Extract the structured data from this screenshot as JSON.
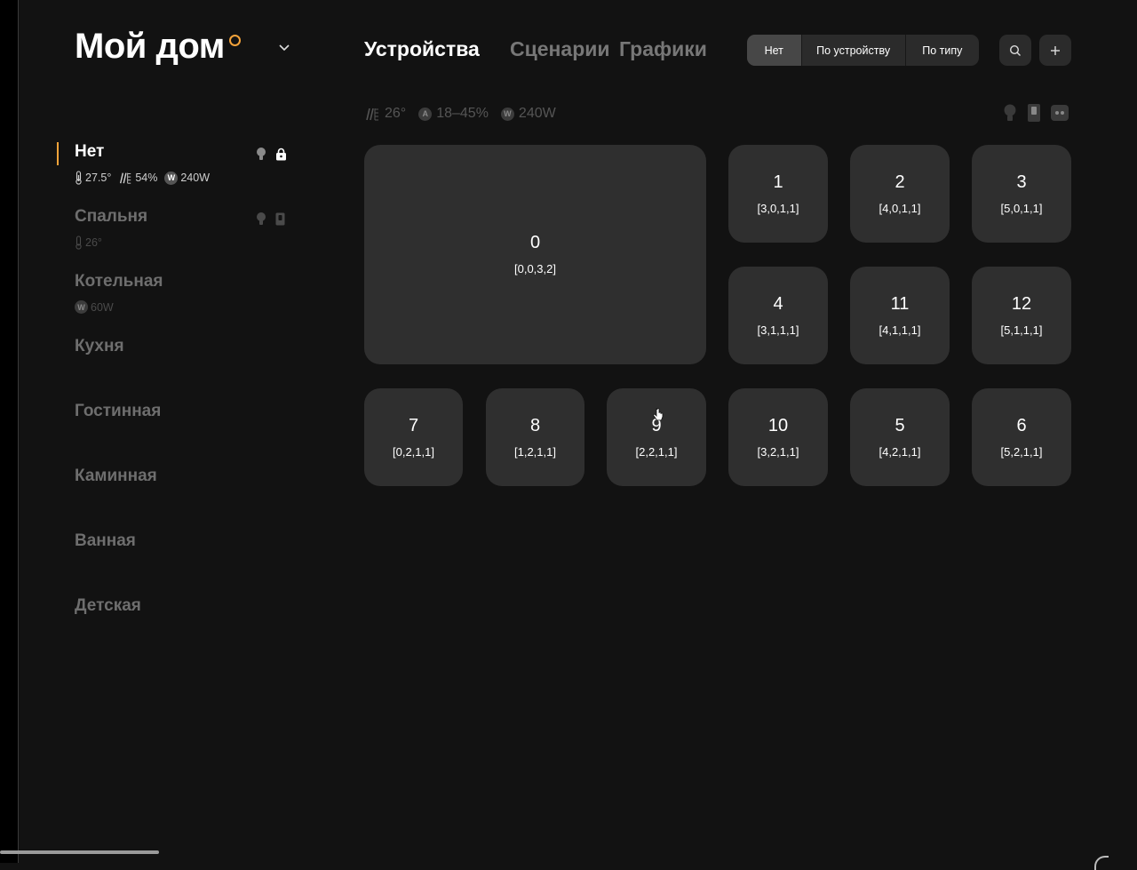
{
  "home": {
    "title": "Мой дом"
  },
  "nav": {
    "tabs": [
      {
        "label": "Устройства"
      },
      {
        "label": "Сценарии"
      },
      {
        "label": "Графики"
      }
    ]
  },
  "grouping": {
    "options": [
      {
        "label": "Нет"
      },
      {
        "label": "По устройству"
      },
      {
        "label": "По типу"
      }
    ],
    "selected": "Нет"
  },
  "summary": {
    "humidity": "26°",
    "air": "18–45%",
    "power": "240W",
    "air_badge": "A",
    "power_badge": "W"
  },
  "rooms": [
    {
      "name": "Нет",
      "active": true,
      "temp": "27.5°",
      "humidity": "54%",
      "power_badge": "W",
      "power": "240W"
    },
    {
      "name": "Спальня",
      "temp": "26°"
    },
    {
      "name": "Котельная",
      "power_badge": "W",
      "power": "60W"
    },
    {
      "name": "Кухня"
    },
    {
      "name": "Гостинная"
    },
    {
      "name": "Каминная"
    },
    {
      "name": "Ванная"
    },
    {
      "name": "Детская"
    }
  ],
  "tiles": [
    {
      "label": "0",
      "coords": "[0,0,3,2]"
    },
    {
      "label": "1",
      "coords": "[3,0,1,1]"
    },
    {
      "label": "2",
      "coords": "[4,0,1,1]"
    },
    {
      "label": "3",
      "coords": "[5,0,1,1]"
    },
    {
      "label": "4",
      "coords": "[3,1,1,1]"
    },
    {
      "label": "11",
      "coords": "[4,1,1,1]"
    },
    {
      "label": "12",
      "coords": "[5,1,1,1]"
    },
    {
      "label": "7",
      "coords": "[0,2,1,1]"
    },
    {
      "label": "8",
      "coords": "[1,2,1,1]"
    },
    {
      "label": "9",
      "coords": "[2,2,1,1]"
    },
    {
      "label": "10",
      "coords": "[3,2,1,1]"
    },
    {
      "label": "5",
      "coords": "[4,2,1,1]"
    },
    {
      "label": "6",
      "coords": "[5,2,1,1]"
    }
  ],
  "colors": {
    "accent": "#f5a33a",
    "background": "#121212",
    "tile": "#2f2f2f",
    "muted": "#6e6e6e"
  },
  "icons": [
    "chevron-down-icon",
    "search-icon",
    "plus-icon",
    "bulb-icon",
    "switch-icon",
    "socket-icon",
    "lock-icon",
    "thermometer-icon",
    "humidity-icon"
  ]
}
